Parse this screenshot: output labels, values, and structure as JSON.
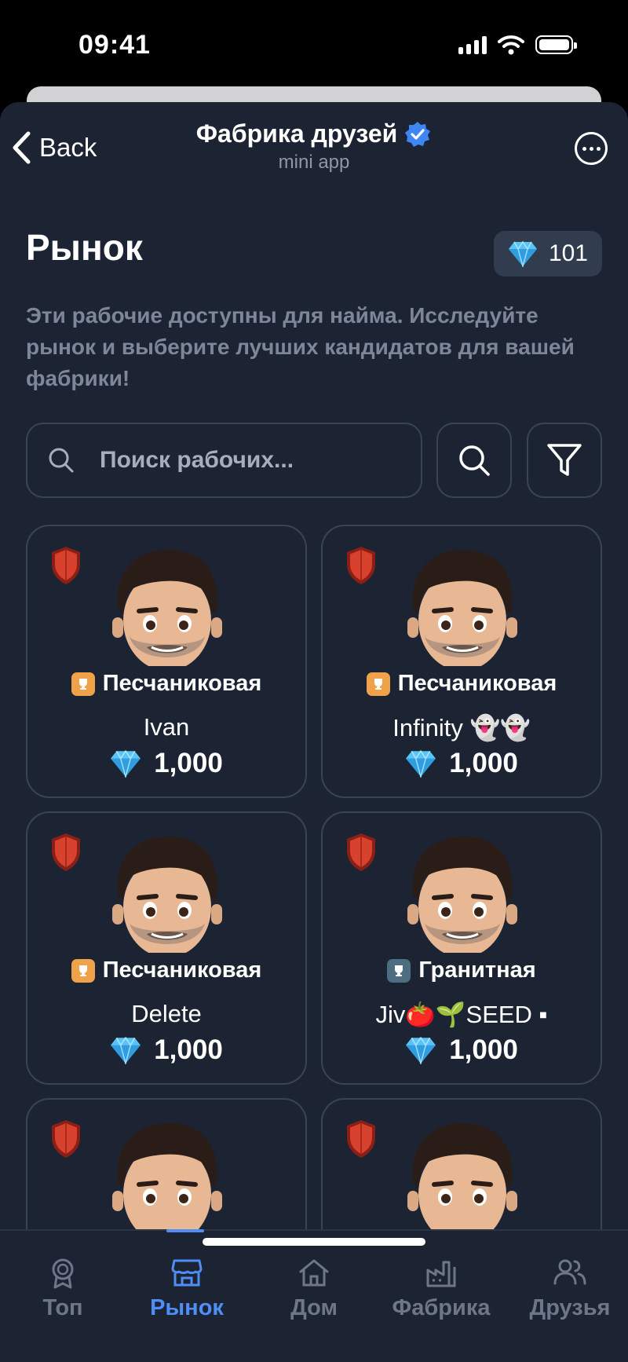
{
  "status_bar": {
    "time": "09:41"
  },
  "header": {
    "back_label": "Back",
    "title": "Фабрика друзей",
    "subtitle": "mini app"
  },
  "page": {
    "title": "Рынок",
    "balance": "101",
    "description": "Эти рабочие доступны для найма. Исследуйте рынок и выберите лучших кандидатов для вашей фабрики!"
  },
  "search": {
    "placeholder": "Поиск рабочих...",
    "value": ""
  },
  "workers": [
    {
      "tier": "Песчаниковая",
      "name": "Ivan",
      "price": "1,000"
    },
    {
      "tier": "Песчаниковая",
      "name": "Infinity 👻👻",
      "price": "1,000"
    },
    {
      "tier": "Песчаниковая",
      "name": "Delete",
      "price": "1,000"
    },
    {
      "tier": "Гранитная",
      "name": "Jiv🍅🌱SEED ▪",
      "price": "1,000"
    }
  ],
  "tabs": [
    {
      "label": "Топ",
      "icon": "medal-icon"
    },
    {
      "label": "Рынок",
      "icon": "store-icon",
      "active": true
    },
    {
      "label": "Дом",
      "icon": "house-icon"
    },
    {
      "label": "Фабрика",
      "icon": "factory-icon"
    },
    {
      "label": "Друзья",
      "icon": "friends-icon"
    }
  ],
  "colors": {
    "accent": "#4f8ef7",
    "background": "#1c2433",
    "sandstone": "#f0a24a",
    "granite": "#5b7a8c",
    "shield": "#c8362a"
  }
}
